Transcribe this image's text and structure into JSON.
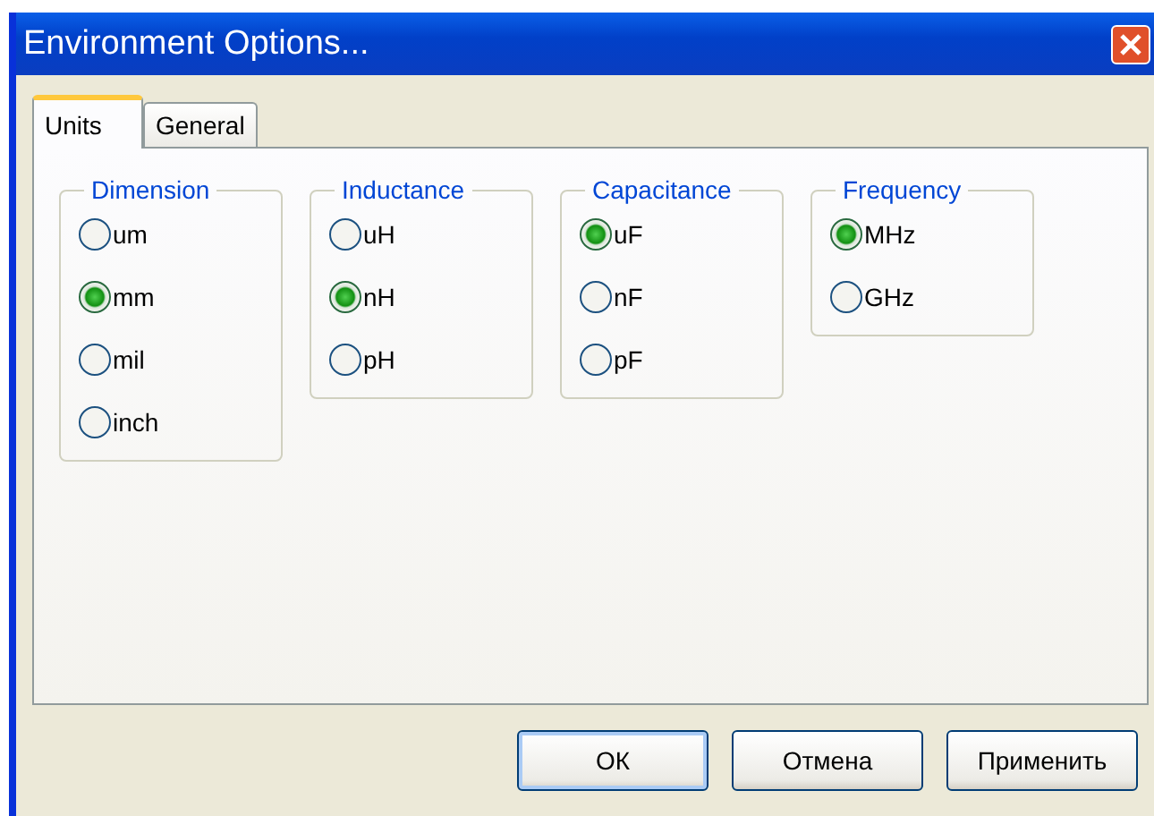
{
  "window": {
    "title": "Environment Options..."
  },
  "tabs": [
    {
      "label": "Units",
      "selected": true
    },
    {
      "label": "General",
      "selected": false
    }
  ],
  "groups": [
    {
      "title": "Dimension",
      "options": [
        {
          "label": "um",
          "selected": false
        },
        {
          "label": "mm",
          "selected": true
        },
        {
          "label": "mil",
          "selected": false
        },
        {
          "label": "inch",
          "selected": false
        }
      ]
    },
    {
      "title": "Inductance",
      "options": [
        {
          "label": "uH",
          "selected": false
        },
        {
          "label": "nH",
          "selected": true
        },
        {
          "label": "pH",
          "selected": false
        }
      ]
    },
    {
      "title": "Capacitance",
      "options": [
        {
          "label": "uF",
          "selected": true
        },
        {
          "label": "nF",
          "selected": false
        },
        {
          "label": "pF",
          "selected": false
        }
      ]
    },
    {
      "title": "Frequency",
      "options": [
        {
          "label": "MHz",
          "selected": true
        },
        {
          "label": "GHz",
          "selected": false
        }
      ]
    }
  ],
  "buttons": [
    {
      "label": "ОК",
      "default": true
    },
    {
      "label": "Отмена",
      "default": false
    },
    {
      "label": "Применить",
      "default": false
    }
  ]
}
